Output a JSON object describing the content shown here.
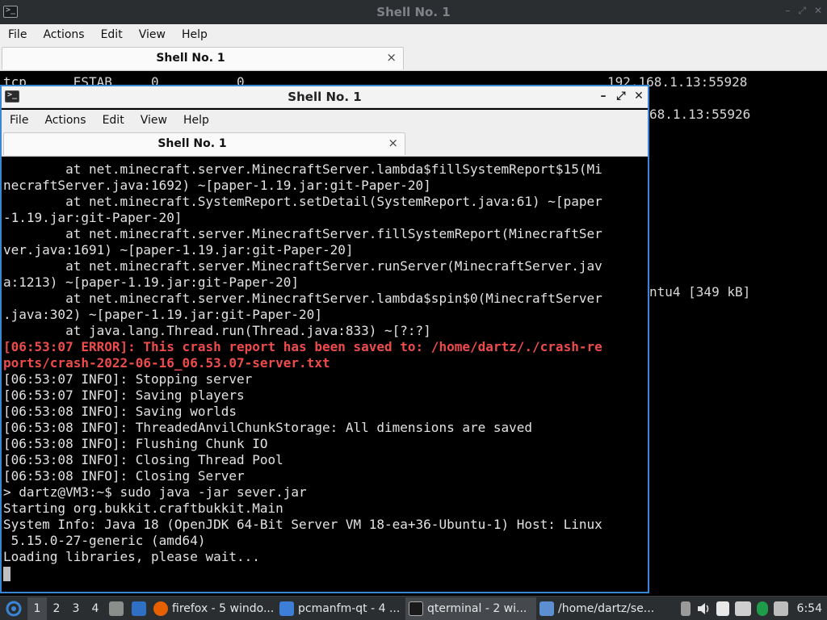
{
  "background_window": {
    "title": "Shell No. 1",
    "menu": [
      "File",
      "Actions",
      "Edit",
      "View",
      "Help"
    ],
    "tab_label": "Shell No. 1",
    "tab_close": "×",
    "visible_lines": {
      "l1_left": "tcp      ESTAB     0          0",
      "l1_right": "192.168.1.13:55928",
      "l2_right": "68.1.13:55926",
      "l3_right": "ntu4 [349 kB]"
    }
  },
  "foreground_window": {
    "title": "Shell No. 1",
    "menu": [
      "File",
      "Actions",
      "Edit",
      "View",
      "Help"
    ],
    "tab_label": "Shell No. 1",
    "tab_close": "×",
    "buttons": {
      "minimize": "–",
      "maximize": "⤢",
      "close": "✕"
    },
    "terminal_lines": [
      "        at net.minecraft.server.MinecraftServer.lambda$fillSystemReport$15(Mi",
      "necraftServer.java:1692) ~[paper-1.19.jar:git-Paper-20]",
      "        at net.minecraft.SystemReport.setDetail(SystemReport.java:61) ~[paper",
      "-1.19.jar:git-Paper-20]",
      "        at net.minecraft.server.MinecraftServer.fillSystemReport(MinecraftSer",
      "ver.java:1691) ~[paper-1.19.jar:git-Paper-20]",
      "        at net.minecraft.server.MinecraftServer.runServer(MinecraftServer.jav",
      "a:1213) ~[paper-1.19.jar:git-Paper-20]",
      "        at net.minecraft.server.MinecraftServer.lambda$spin$0(MinecraftServer",
      ".java:302) ~[paper-1.19.jar:git-Paper-20]",
      "        at java.lang.Thread.run(Thread.java:833) ~[?:?]",
      "[06:53:07 ERROR]: This crash report has been saved to: /home/dartz/./crash-re",
      "ports/crash-2022-06-16_06.53.07-server.txt",
      "[06:53:07 INFO]: Stopping server",
      "[06:53:07 INFO]: Saving players",
      "[06:53:08 INFO]: Saving worlds",
      "[06:53:08 INFO]: ThreadedAnvilChunkStorage: All dimensions are saved",
      "[06:53:08 INFO]: Flushing Chunk IO",
      "[06:53:08 INFO]: Closing Thread Pool",
      "[06:53:08 INFO]: Closing Server",
      "> dartz@VM3:~$ sudo java -jar sever.jar",
      "Starting org.bukkit.craftbukkit.Main",
      "System Info: Java 18 (OpenJDK 64-Bit Server VM 18-ea+36-Ubuntu-1) Host: Linux",
      " 5.15.0-27-generic (amd64)",
      "Loading libraries, please wait..."
    ],
    "error_line_indices": [
      11,
      12
    ]
  },
  "taskbar": {
    "workspaces": [
      "1",
      "2",
      "3",
      "4"
    ],
    "active_workspace": "1",
    "tasks": [
      {
        "label": "firefox - 5 windo...",
        "icon": "firefox-icon",
        "color": "#e66000"
      },
      {
        "label": "pcmanfm-qt - 4 ...",
        "icon": "folder-icon",
        "color": "#3d7fd6"
      },
      {
        "label": "qterminal - 2 wi...",
        "icon": "terminal-icon",
        "color": "#1a1a1a",
        "active": true
      },
      {
        "label": "/home/dartz/se...",
        "icon": "text-editor-icon",
        "color": "#5b8fd0"
      }
    ],
    "clock": "6:54"
  },
  "colors": {
    "accent": "#3a86d6",
    "error_text": "#ee4b4b",
    "terminal_text": "#e2e2e2",
    "panel_bg": "#2b2e31"
  }
}
